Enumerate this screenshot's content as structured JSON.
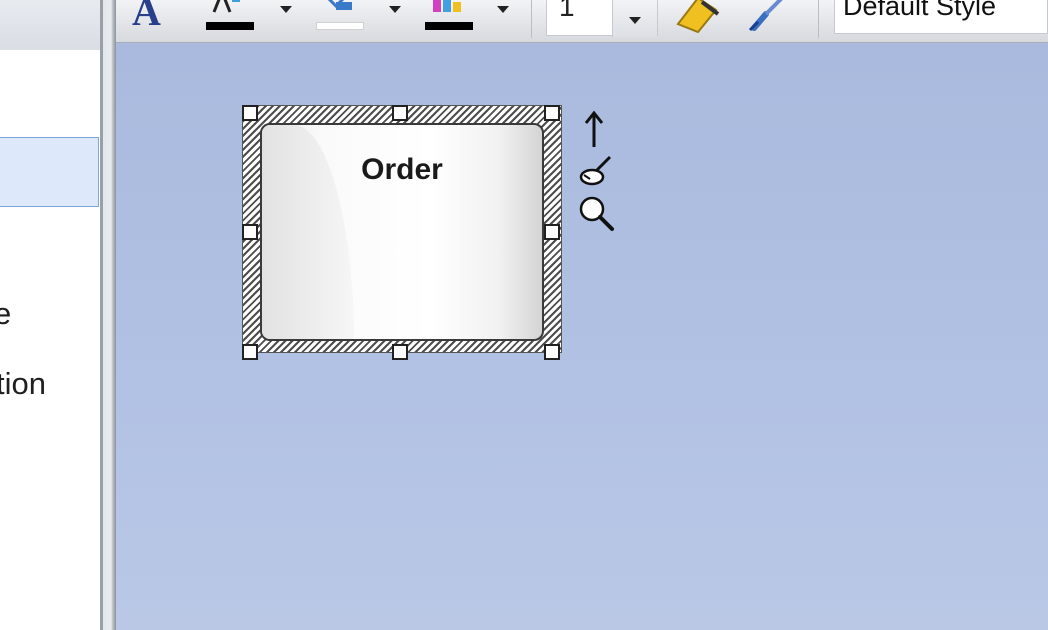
{
  "left_panel": {
    "labels": [
      "e",
      "tion"
    ]
  },
  "toolbar": {
    "font_button_letter": "A",
    "font_color_icon": "font-color-icon",
    "fill_color_icon": "fill-color-icon",
    "line_color_icon": "line-color-icon",
    "line_width_value": "1",
    "format_painter_icon": "format-painter-icon",
    "style_brush_icon": "style-brush-icon",
    "style_value": "Default Style",
    "colors": {
      "font_color_bar": "#000000",
      "fill_color_bar": "#ffffff",
      "line_color_bar": "#000000"
    }
  },
  "diagram": {
    "element": {
      "name": "Order",
      "selected": true
    },
    "quick_tools": [
      "quick-linker-arrow-icon",
      "appearance-brush-icon",
      "zoom-magnifier-icon"
    ]
  },
  "theme": {
    "canvas_color": "#aebfe2",
    "panel_selection_color": "#dde8fa"
  }
}
